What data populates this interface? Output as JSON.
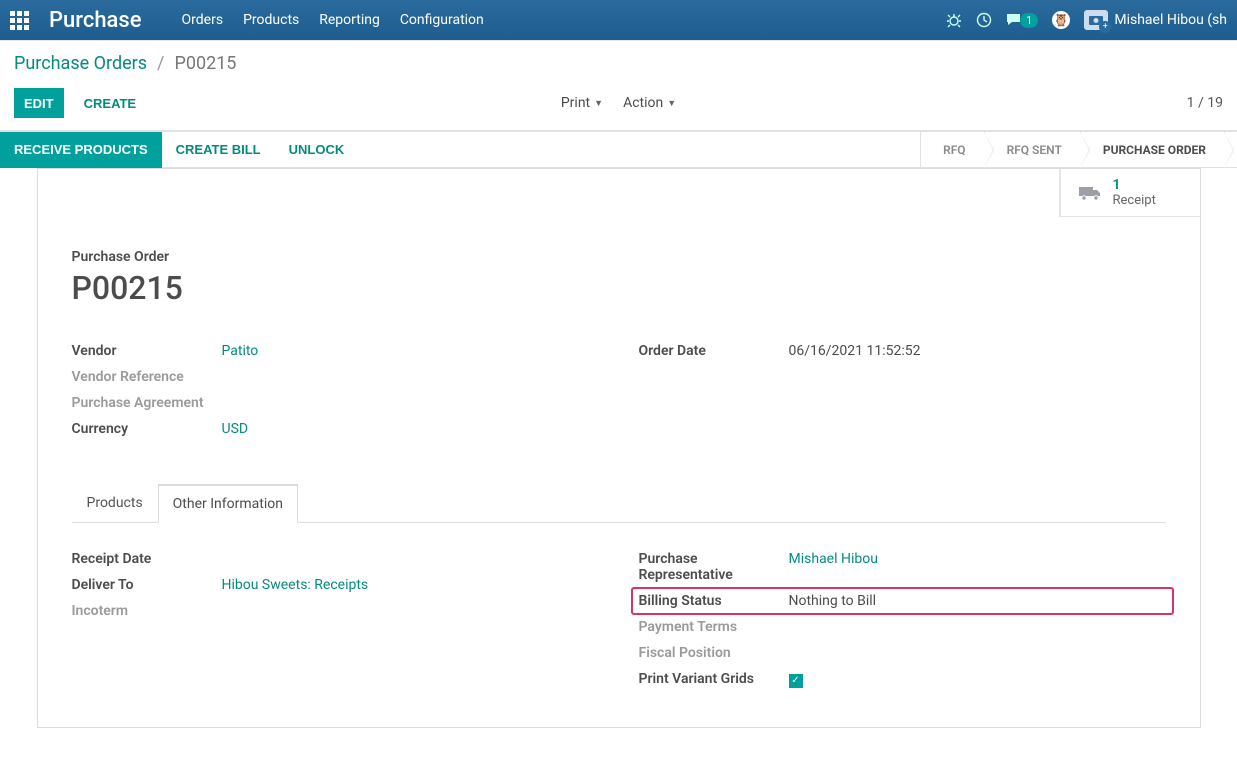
{
  "nav": {
    "brand": "Purchase",
    "menu": [
      "Orders",
      "Products",
      "Reporting",
      "Configuration"
    ],
    "messages_count": "1",
    "user_name": "Mishael Hibou (sh"
  },
  "breadcrumb": {
    "parent": "Purchase Orders",
    "sep": "/",
    "current": "P00215"
  },
  "buttons": {
    "edit": "EDIT",
    "create": "CREATE",
    "print": "Print",
    "action": "Action",
    "pager": "1 / 19"
  },
  "statusbar": {
    "left": [
      "RECEIVE PRODUCTS",
      "CREATE BILL",
      "UNLOCK"
    ],
    "steps": [
      "RFQ",
      "RFQ SENT",
      "PURCHASE ORDER"
    ]
  },
  "stat": {
    "count": "1",
    "label": "Receipt"
  },
  "form": {
    "title_label": "Purchase Order",
    "title_value": "P00215",
    "left": {
      "vendor_label": "Vendor",
      "vendor_value": "Patito",
      "vendor_ref_label": "Vendor Reference",
      "agreement_label": "Purchase Agreement",
      "currency_label": "Currency",
      "currency_value": "USD"
    },
    "right": {
      "order_date_label": "Order Date",
      "order_date_value": "06/16/2021 11:52:52"
    }
  },
  "tabs": {
    "products": "Products",
    "other_info": "Other Information"
  },
  "other_info": {
    "left": {
      "receipt_date_label": "Receipt Date",
      "deliver_to_label": "Deliver To",
      "deliver_to_value": "Hibou Sweets: Receipts",
      "incoterm_label": "Incoterm"
    },
    "right": {
      "rep_label": "Purchase Representative",
      "rep_value": "Mishael Hibou",
      "billing_label": "Billing Status",
      "billing_value": "Nothing to Bill",
      "terms_label": "Payment Terms",
      "fiscal_label": "Fiscal Position",
      "grids_label": "Print Variant Grids"
    }
  }
}
